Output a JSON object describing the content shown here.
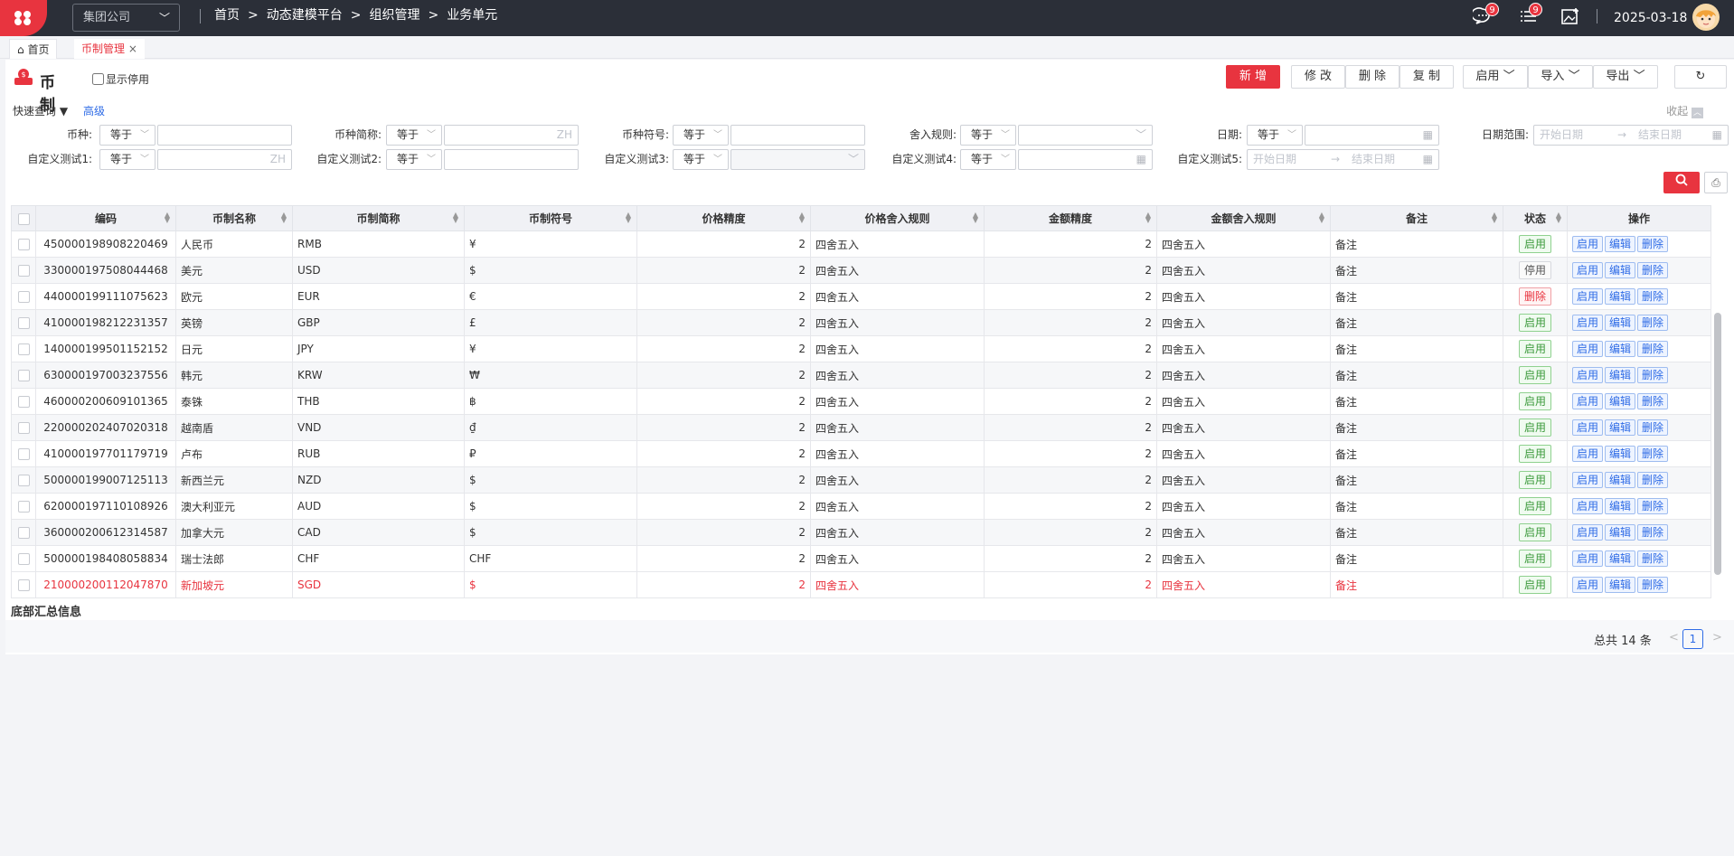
{
  "company": "集团公司",
  "breadcrumb": [
    "首页",
    ">",
    "动态建模平台",
    ">",
    "组织管理",
    ">",
    "业务单元"
  ],
  "notifications": {
    "chat": "9",
    "list": "9"
  },
  "date": "2025-03-18",
  "tabs": {
    "home": "首页",
    "active": "币制管理",
    "close": "×"
  },
  "page": {
    "title": "币制",
    "show_disabled": "显示停用"
  },
  "toolbar": {
    "add": "新 增",
    "edit": "修 改",
    "delete": "删 除",
    "copy": "复 制",
    "enable": "启用",
    "import": "导入",
    "export": "导出"
  },
  "query": {
    "quick": "快速查询 ▼",
    "advanced": "高级",
    "collapse": "收起"
  },
  "filters": {
    "currency": "币种:",
    "abbr": "币种简称:",
    "symbol": "币种符号:",
    "round": "舍入规则:",
    "date": "日期:",
    "date_range": "日期范围:",
    "c1": "自定义测试1:",
    "c2": "自定义测试2:",
    "c3": "自定义测试3:",
    "c4": "自定义测试4:",
    "c5": "自定义测试5:",
    "eq": "等于",
    "zh": "ZH",
    "start": "开始日期",
    "end": "结束日期",
    "arrow": "→"
  },
  "columns": [
    "编码",
    "币制名称",
    "币制简称",
    "币制符号",
    "价格精度",
    "价格舍入规则",
    "金额精度",
    "金额舍入规则",
    "备注",
    "状态",
    "操作"
  ],
  "ops": {
    "enable": "启用",
    "edit": "编辑",
    "delete": "删除"
  },
  "rows": [
    {
      "code": "450000198908220469",
      "name": "人民币",
      "abbr": "RMB",
      "sym": "¥",
      "pp": "2",
      "pr": "四舍五入",
      "ap": "2",
      "ar": "四舍五入",
      "note": "备注",
      "status": "启用"
    },
    {
      "code": "330000197508044468",
      "name": "美元",
      "abbr": "USD",
      "sym": "$",
      "pp": "2",
      "pr": "四舍五入",
      "ap": "2",
      "ar": "四舍五入",
      "note": "备注",
      "status": "停用"
    },
    {
      "code": "440000199111075623",
      "name": "欧元",
      "abbr": "EUR",
      "sym": "€",
      "pp": "2",
      "pr": "四舍五入",
      "ap": "2",
      "ar": "四舍五入",
      "note": "备注",
      "status": "删除"
    },
    {
      "code": "410000198212231357",
      "name": "英镑",
      "abbr": "GBP",
      "sym": "£",
      "pp": "2",
      "pr": "四舍五入",
      "ap": "2",
      "ar": "四舍五入",
      "note": "备注",
      "status": "启用"
    },
    {
      "code": "140000199501152152",
      "name": "日元",
      "abbr": "JPY",
      "sym": "¥",
      "pp": "2",
      "pr": "四舍五入",
      "ap": "2",
      "ar": "四舍五入",
      "note": "备注",
      "status": "启用"
    },
    {
      "code": "630000197003237556",
      "name": "韩元",
      "abbr": "KRW",
      "sym": "₩",
      "pp": "2",
      "pr": "四舍五入",
      "ap": "2",
      "ar": "四舍五入",
      "note": "备注",
      "status": "启用"
    },
    {
      "code": "460000200609101365",
      "name": "泰铢",
      "abbr": "THB",
      "sym": "฿",
      "pp": "2",
      "pr": "四舍五入",
      "ap": "2",
      "ar": "四舍五入",
      "note": "备注",
      "status": "启用"
    },
    {
      "code": "220000202407020318",
      "name": "越南盾",
      "abbr": "VND",
      "sym": "₫",
      "pp": "2",
      "pr": "四舍五入",
      "ap": "2",
      "ar": "四舍五入",
      "note": "备注",
      "status": "启用"
    },
    {
      "code": "410000197701179719",
      "name": "卢布",
      "abbr": "RUB",
      "sym": "₽",
      "pp": "2",
      "pr": "四舍五入",
      "ap": "2",
      "ar": "四舍五入",
      "note": "备注",
      "status": "启用"
    },
    {
      "code": "500000199007125113",
      "name": "新西兰元",
      "abbr": "NZD",
      "sym": "$",
      "pp": "2",
      "pr": "四舍五入",
      "ap": "2",
      "ar": "四舍五入",
      "note": "备注",
      "status": "启用"
    },
    {
      "code": "620000197110108926",
      "name": "澳大利亚元",
      "abbr": "AUD",
      "sym": "$",
      "pp": "2",
      "pr": "四舍五入",
      "ap": "2",
      "ar": "四舍五入",
      "note": "备注",
      "status": "启用"
    },
    {
      "code": "360000200612314587",
      "name": "加拿大元",
      "abbr": "CAD",
      "sym": "$",
      "pp": "2",
      "pr": "四舍五入",
      "ap": "2",
      "ar": "四舍五入",
      "note": "备注",
      "status": "启用"
    },
    {
      "code": "500000198408058834",
      "name": "瑞士法郎",
      "abbr": "CHF",
      "sym": "CHF",
      "pp": "2",
      "pr": "四舍五入",
      "ap": "2",
      "ar": "四舍五入",
      "note": "备注",
      "status": "启用"
    },
    {
      "code": "210000200112047870",
      "name": "新加坡元",
      "abbr": "SGD",
      "sym": "$",
      "pp": "2",
      "pr": "四舍五入",
      "ap": "2",
      "ar": "四舍五入",
      "note": "备注",
      "status": "启用"
    }
  ],
  "footer": {
    "summary": "底部汇总信息",
    "total": "总共 14 条",
    "page": "1",
    "prev": "<",
    "next": ">"
  },
  "colors": {
    "accent": "#e8343f",
    "link": "#2e6be6",
    "topbar": "#2b2f38"
  }
}
